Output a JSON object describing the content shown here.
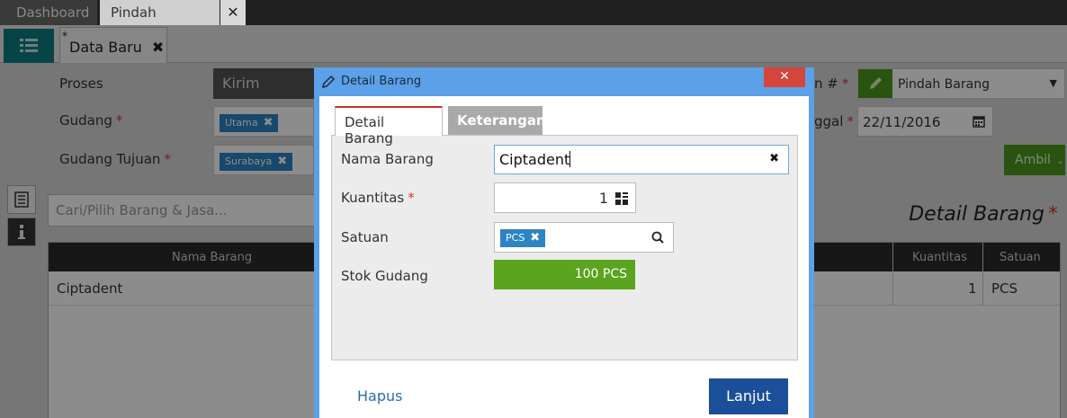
{
  "top_tabs": {
    "dashboard": "Dashboard",
    "pindah_barang": "Pindah Barang",
    "close": "✕"
  },
  "sub_tab": {
    "label": "Data Baru",
    "modified_mark": "*",
    "close": "✖"
  },
  "form": {
    "proses_label": "Proses",
    "proses_value": "Kirim Barang",
    "gudang_label": "Gudang",
    "gudang_chip": "Utama",
    "gudang_tujuan_label": "Gudang Tujuan",
    "gudang_tujuan_chip": "Surabaya",
    "required_mark": "*",
    "right_label_1": "n #",
    "right_value_1": "Pindah Barang",
    "right_label_2": "ggal",
    "right_value_2": "22/11/2016",
    "ambil_label": "Ambil"
  },
  "search": {
    "placeholder": "Cari/Pilih Barang & Jasa..."
  },
  "detail_title": "Detail Barang",
  "grid": {
    "headers": [
      "Nama Barang",
      "Kuantitas",
      "Satuan"
    ],
    "rows": [
      {
        "nama": "Ciptadent",
        "kuantitas": "1",
        "satuan": "PCS"
      }
    ]
  },
  "modal": {
    "title": "Detail Barang",
    "close": "✕",
    "tabs": [
      "Detail Barang",
      "Keterangan"
    ],
    "fields": {
      "nama_label": "Nama Barang",
      "nama_value": "Ciptadent",
      "kuantitas_label": "Kuantitas",
      "kuantitas_value": "1",
      "satuan_label": "Satuan",
      "satuan_chip": "PCS",
      "stok_label": "Stok Gudang",
      "stok_value": "100 PCS"
    },
    "hapus": "Hapus",
    "lanjut": "Lanjut"
  },
  "colors": {
    "accent_blue": "#5ca0e8",
    "chip_blue": "#2d84c5",
    "green": "#5aa41f",
    "primary_button": "#1b4f99",
    "close_red": "#d4453c",
    "teal": "#0d7c82"
  },
  "icons": [
    "list-icon",
    "pencil-icon",
    "close-icon",
    "clear-icon",
    "calculator-icon",
    "search-icon",
    "calendar-icon",
    "dropdown-arrow-icon",
    "document-icon",
    "info-icon",
    "chevron-down-icon"
  ]
}
